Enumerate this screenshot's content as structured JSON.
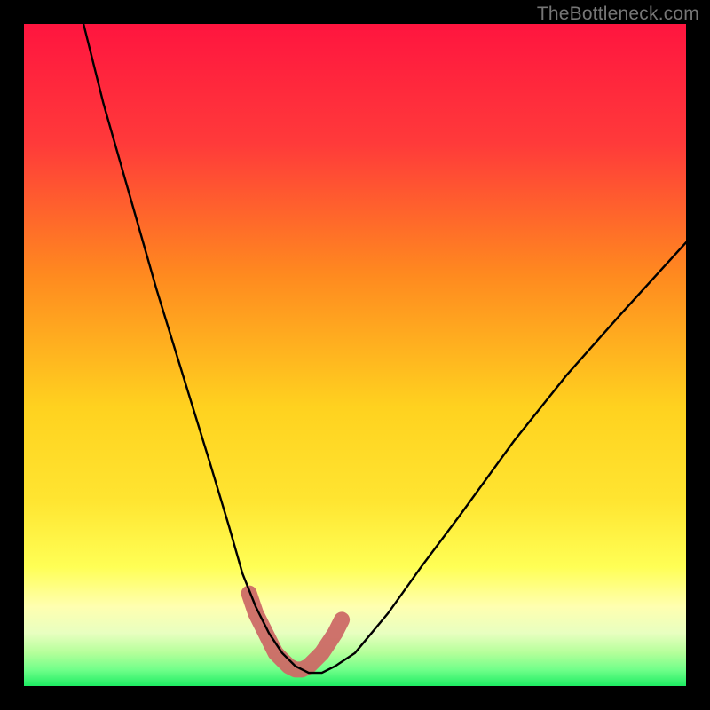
{
  "watermark": "TheBottleneck.com",
  "colors": {
    "frame": "#000000",
    "top": "#ff153f",
    "mid_orange": "#ff8a1f",
    "yellow": "#ffe531",
    "pale_yellow": "#ffff9c",
    "light_green": "#9cff7a",
    "green": "#1eed63",
    "curve": "#000000",
    "marker": "#cc6a66"
  },
  "chart_data": {
    "type": "line",
    "title": "",
    "xlabel": "",
    "ylabel": "",
    "xlim": [
      0,
      100
    ],
    "ylim": [
      0,
      100
    ],
    "series": [
      {
        "name": "bottleneck-curve",
        "x": [
          9,
          12,
          16,
          20,
          24,
          28,
          31,
          33,
          35,
          37,
          39,
          41,
          43,
          45,
          47,
          50,
          55,
          60,
          66,
          74,
          82,
          90,
          100
        ],
        "y": [
          100,
          88,
          74,
          60,
          47,
          34,
          24,
          17,
          12,
          8,
          5,
          3,
          2,
          2,
          3,
          5,
          11,
          18,
          26,
          37,
          47,
          56,
          67
        ]
      }
    ],
    "markers": {
      "name": "marker-band",
      "x": [
        34,
        35,
        36,
        37,
        38,
        39,
        40,
        41,
        42,
        43,
        44,
        45,
        46,
        47,
        48
      ],
      "y": [
        14,
        11,
        9,
        7,
        5,
        4,
        3,
        2.5,
        2.5,
        3,
        4,
        5,
        6.5,
        8,
        10
      ]
    }
  }
}
